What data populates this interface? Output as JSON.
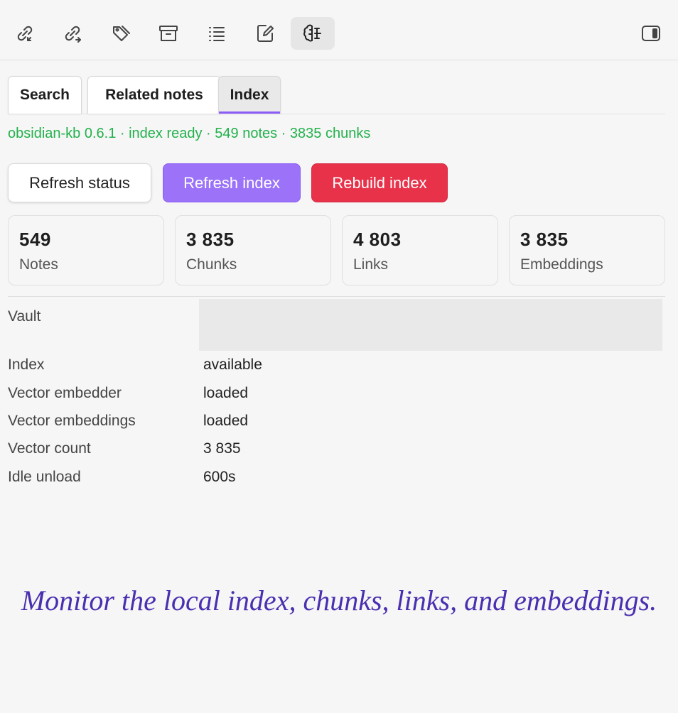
{
  "toolbar": {
    "icons": [
      {
        "name": "backlinks-icon"
      },
      {
        "name": "outgoing-links-icon"
      },
      {
        "name": "tags-icon"
      },
      {
        "name": "archive-icon"
      },
      {
        "name": "outline-icon"
      },
      {
        "name": "edit-note-icon"
      },
      {
        "name": "brain-icon",
        "active": true
      }
    ],
    "right_icon": "sidebar-toggle-icon"
  },
  "tabs": [
    {
      "label": "Search"
    },
    {
      "label": "Related notes"
    },
    {
      "label": "Index",
      "active": true
    }
  ],
  "status": "obsidian-kb 0.6.1 · index ready · 549 notes · 3835 chunks",
  "buttons": {
    "refresh_status": "Refresh status",
    "refresh_index": "Refresh index",
    "rebuild_index": "Rebuild index"
  },
  "stats": [
    {
      "value": "549",
      "label": "Notes"
    },
    {
      "value": "3 835",
      "label": "Chunks"
    },
    {
      "value": "4 803",
      "label": "Links"
    },
    {
      "value": "3 835",
      "label": "Embeddings"
    }
  ],
  "details": {
    "vault_label": "Vault",
    "vault_value": "",
    "rows": [
      {
        "label": "Index",
        "value": "available"
      },
      {
        "label": "Vector embedder",
        "value": "loaded"
      },
      {
        "label": "Vector embeddings",
        "value": "loaded"
      },
      {
        "label": "Vector count",
        "value": "3 835"
      },
      {
        "label": "Idle unload",
        "value": "600s"
      }
    ]
  },
  "caption": "Monitor the local index, chunks, links, and embeddings.",
  "colors": {
    "accent": "#8b5cf6",
    "status_green": "#22b14c",
    "danger": "#e8324a",
    "caption": "#4a2fb0"
  }
}
